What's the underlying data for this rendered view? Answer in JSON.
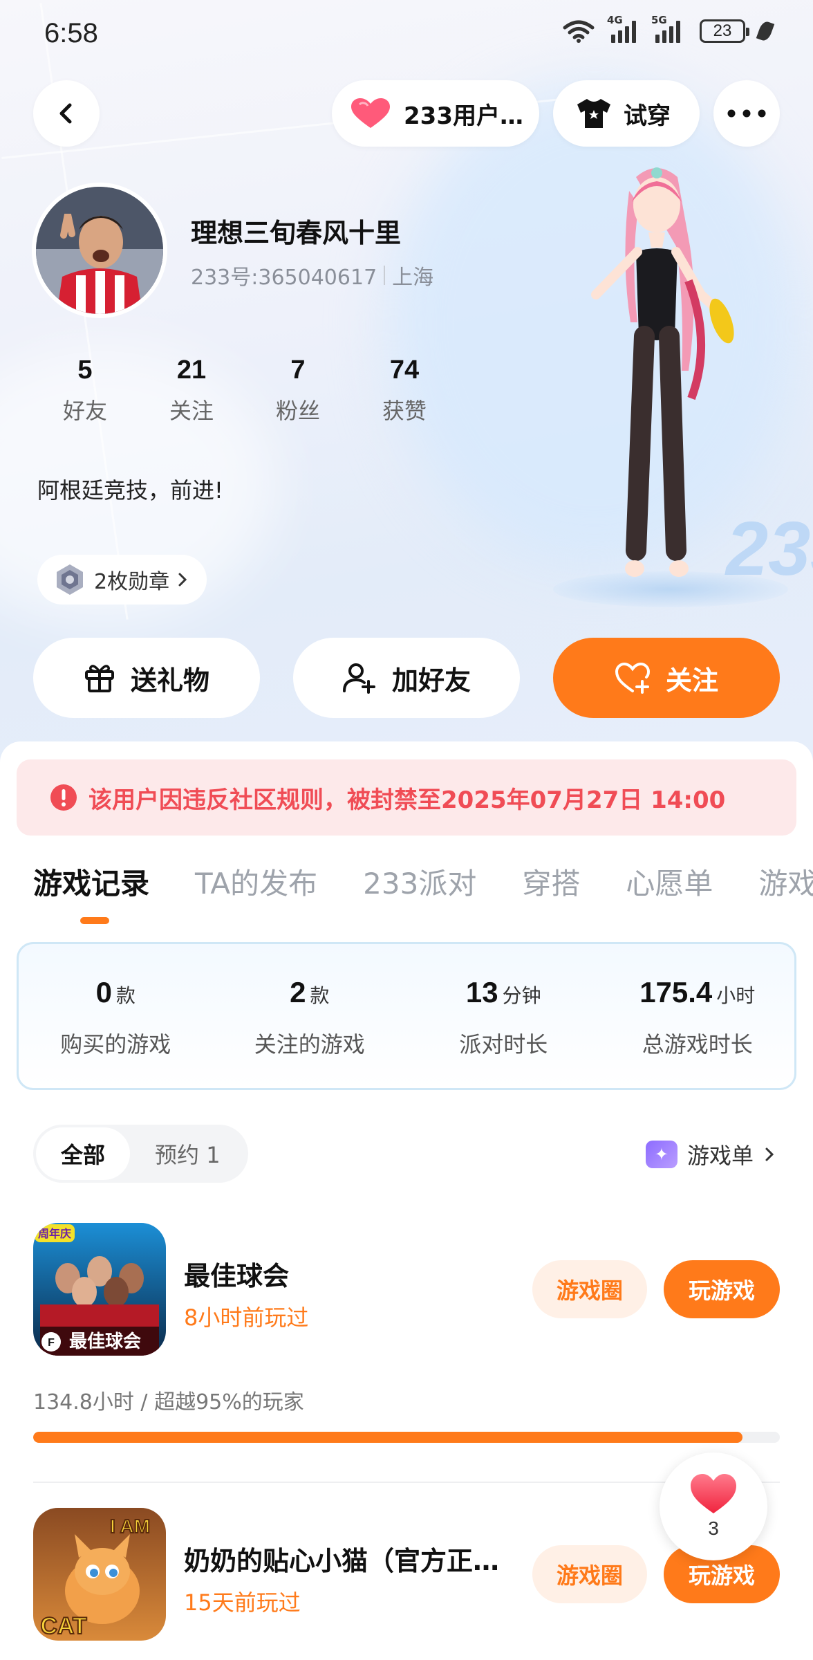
{
  "status_bar": {
    "time": "6:58",
    "net1": "4G",
    "net2": "5G",
    "battery": "23"
  },
  "header": {
    "likes_pill": "233用户…",
    "try_on": "试穿"
  },
  "profile": {
    "name": "理想三旬春风十里",
    "id": "233号:365040617",
    "location": "上海",
    "stats": [
      {
        "value": "5",
        "label": "好友"
      },
      {
        "value": "21",
        "label": "关注"
      },
      {
        "value": "7",
        "label": "粉丝"
      },
      {
        "value": "74",
        "label": "获赞"
      }
    ],
    "bio": "阿根廷竞技，前进!",
    "medals": "2枚勋章"
  },
  "actions": {
    "gift": "送礼物",
    "add_friend": "加好友",
    "follow": "关注"
  },
  "ban_notice": "该用户因违反社区规则，被封禁至2025年07月27日 14:00",
  "tabs": [
    "游戏记录",
    "TA的发布",
    "233派对",
    "穿搭",
    "心愿单",
    "游戏"
  ],
  "summary": [
    {
      "value": "0",
      "unit": "款",
      "label": "购买的游戏"
    },
    {
      "value": "2",
      "unit": "款",
      "label": "关注的游戏"
    },
    {
      "value": "13",
      "unit": "分钟",
      "label": "派对时长"
    },
    {
      "value": "175.4",
      "unit": "小时",
      "label": "总游戏时长"
    }
  ],
  "filters": {
    "all": "全部",
    "reserve": "预约 1"
  },
  "game_list_link": "游戏单",
  "games": [
    {
      "name": "最佳球会",
      "last_played": "8小时前玩过",
      "circle_btn": "游戏圈",
      "play_btn": "玩游戏",
      "playtime": "134.8小时 / 超越95%的玩家",
      "progress": 0.95,
      "icon_badge": "周年庆",
      "icon_text": "最佳球会"
    },
    {
      "name": "奶奶的贴心小猫（官方正…",
      "last_played": "15天前玩过",
      "circle_btn": "游戏圈",
      "play_btn": "玩游戏",
      "icon_text_top": "I AM",
      "icon_text_bottom": "CAT"
    }
  ],
  "floating_like": {
    "count": "3"
  },
  "colors": {
    "accent": "#ff7a1a",
    "ban_bg": "#fde9ea",
    "ban_text": "#f04c55"
  }
}
